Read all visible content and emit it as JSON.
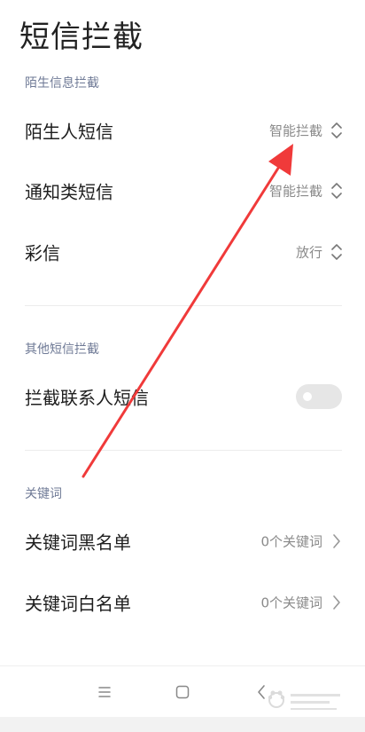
{
  "header": {
    "title": "短信拦截"
  },
  "sections": {
    "stranger": {
      "label": "陌生信息拦截",
      "rows": [
        {
          "title": "陌生人短信",
          "value": "智能拦截"
        },
        {
          "title": "通知类短信",
          "value": "智能拦截"
        },
        {
          "title": "彩信",
          "value": "放行"
        }
      ]
    },
    "other": {
      "label": "其他短信拦截",
      "rows": [
        {
          "title": "拦截联系人短信",
          "toggle": false
        }
      ]
    },
    "keywords": {
      "label": "关键词",
      "rows": [
        {
          "title": "关键词黑名单",
          "value": "0个关键词"
        },
        {
          "title": "关键词白名单",
          "value": "0个关键词"
        }
      ]
    }
  },
  "navbar": {
    "items": [
      "menu",
      "home",
      "back"
    ]
  },
  "colors": {
    "section_header": "#6f7a96",
    "value_text": "#8a8a8a",
    "annotation_arrow": "#f03a3a",
    "toggle_off": "#e6e6e6"
  },
  "icons": {
    "spinner": "unfold-icon",
    "chevron": "chevron-right-icon",
    "menu": "menu-icon",
    "home": "home-icon",
    "back": "back-icon"
  }
}
